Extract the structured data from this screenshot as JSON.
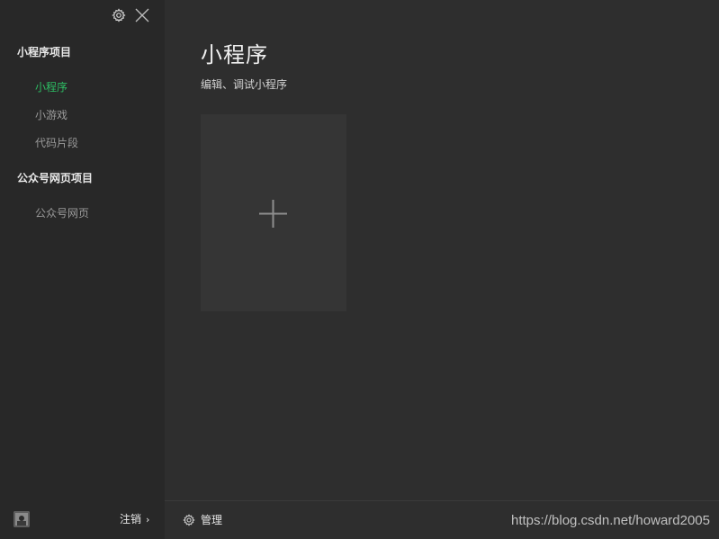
{
  "sidebar": {
    "groups": [
      {
        "title": "小程序项目",
        "items": [
          {
            "label": "小程序",
            "active": true
          },
          {
            "label": "小游戏",
            "active": false
          },
          {
            "label": "代码片段",
            "active": false
          }
        ]
      },
      {
        "title": "公众号网页项目",
        "items": [
          {
            "label": "公众号网页",
            "active": false
          }
        ]
      }
    ],
    "footer": {
      "logout_label": "注销",
      "logout_chevron": "›"
    },
    "icons": {
      "settings": "gear-icon",
      "close": "close-icon"
    }
  },
  "main": {
    "title": "小程序",
    "subtitle": "编辑、调试小程序",
    "new_card_icon": "plus-icon"
  },
  "bottom_bar": {
    "manage_label": "管理",
    "watermark": "https://blog.csdn.net/howard2005"
  },
  "colors": {
    "active": "#2dbd63",
    "background": "#2e2e2e",
    "sidebar": "#282828",
    "card": "#353535"
  }
}
